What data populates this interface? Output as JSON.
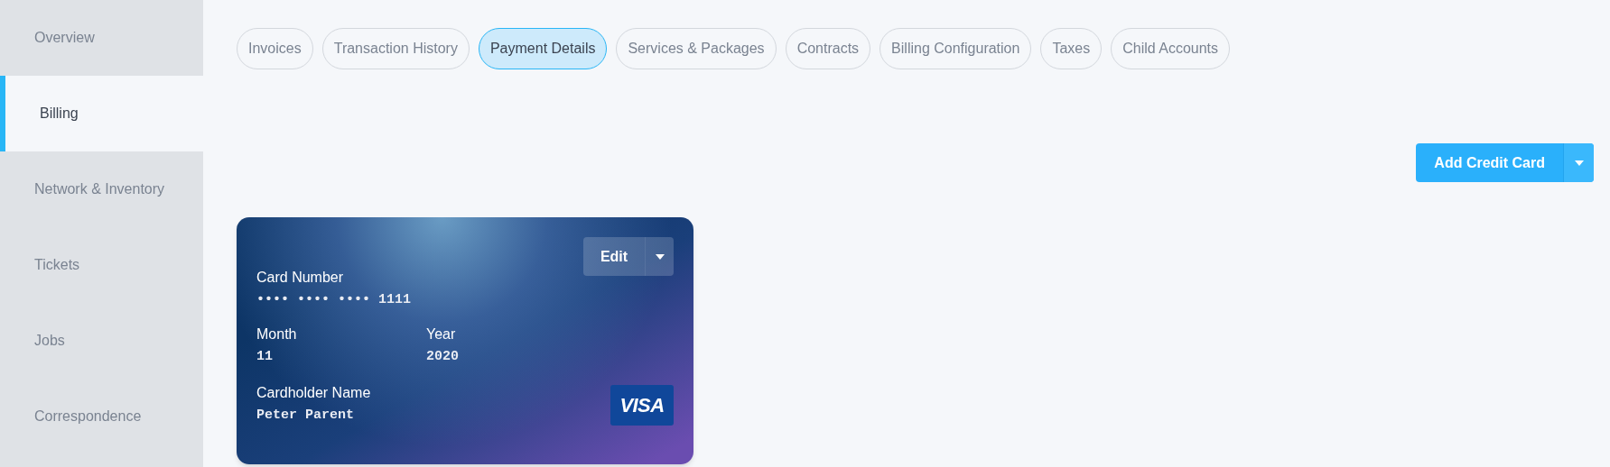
{
  "sidebar": {
    "items": [
      {
        "label": "Overview",
        "selected": false
      },
      {
        "label": "Billing",
        "selected": true
      },
      {
        "label": "Network & Inventory",
        "selected": false
      },
      {
        "label": "Tickets",
        "selected": false
      },
      {
        "label": "Jobs",
        "selected": false
      },
      {
        "label": "Correspondence",
        "selected": false
      }
    ]
  },
  "tabs": [
    {
      "label": "Invoices",
      "selected": false
    },
    {
      "label": "Transaction History",
      "selected": false
    },
    {
      "label": "Payment Details",
      "selected": true
    },
    {
      "label": "Services & Packages",
      "selected": false
    },
    {
      "label": "Contracts",
      "selected": false
    },
    {
      "label": "Billing Configuration",
      "selected": false
    },
    {
      "label": "Taxes",
      "selected": false
    },
    {
      "label": "Child Accounts",
      "selected": false
    }
  ],
  "add_button": {
    "label": "Add Credit Card"
  },
  "card": {
    "edit_label": "Edit",
    "number_label": "Card Number",
    "number": "•••• •••• •••• 1111",
    "month_label": "Month",
    "month": "11",
    "year_label": "Year",
    "year": "2020",
    "holder_label": "Cardholder Name",
    "holder": "Peter Parent",
    "brand": "VISA"
  }
}
